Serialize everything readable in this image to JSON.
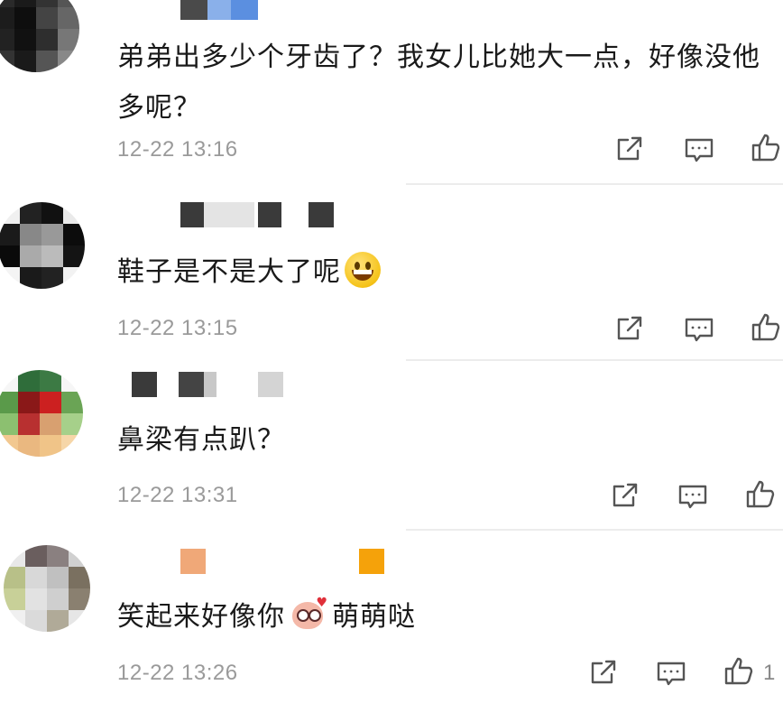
{
  "comments": [
    {
      "text": "弟弟出多少个牙齿了？我女儿比她大一点，好像没他多呢？",
      "timestamp": "12-22 13:16",
      "emoji": ""
    },
    {
      "text": "鞋子是不是大了呢",
      "timestamp": "12-22 13:15",
      "emoji": "smiling-face-emoji"
    },
    {
      "text": "鼻梁有点趴？",
      "timestamp": "12-22 13:31",
      "emoji": ""
    },
    {
      "text_before": "笑起来好像你",
      "text_after": "萌萌哒",
      "timestamp": "12-22 13:26",
      "emoji": "cute-pig-sticker",
      "like_count": "1"
    }
  ],
  "icons": {
    "share": "share-icon",
    "reply": "comment-icon",
    "like": "thumbs-up-icon"
  },
  "colors": {
    "text": "#1a1a1a",
    "timestamp": "#9a9a9a",
    "icon": "#555555",
    "divider": "#ececec"
  }
}
